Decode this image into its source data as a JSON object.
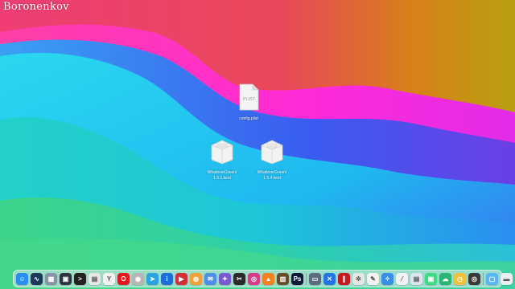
{
  "watermark": {
    "text": "Boronenkov"
  },
  "desktop": {
    "files": [
      {
        "id": "config",
        "label": "config.plist",
        "doc_text": "PLIST"
      },
      {
        "id": "kext1",
        "label": "WhateverGreen/\n1.5.1.kext"
      },
      {
        "id": "kext2",
        "label": "WhateverGreen/\n1.5.4.kext"
      }
    ]
  },
  "wallpaper_colors": {
    "magenta": "#e7387a",
    "orange": "#e0731c",
    "olive": "#b49a12",
    "pink": "#ff2bd6",
    "blue": "#3f54ee",
    "cyan": "#22d4f0",
    "teal": "#1ec9b5",
    "green": "#3ad27c"
  },
  "dock": {
    "items": [
      {
        "name": "finder-icon",
        "color": "#2a8df0",
        "glyph": "☺"
      },
      {
        "name": "activity-monitor-icon",
        "color": "#1e3a5a",
        "glyph": "∿"
      },
      {
        "name": "launchpad-icon",
        "color": "#8a94a8",
        "glyph": "▦"
      },
      {
        "name": "mission-control-icon",
        "color": "#2d3440",
        "glyph": "▣"
      },
      {
        "name": "terminal-icon",
        "color": "#222222",
        "glyph": ">"
      },
      {
        "name": "preview-icon",
        "color": "#e8e8e8",
        "glyph": "▤"
      },
      {
        "name": "yandex-browser-icon",
        "color": "#f2f2f2",
        "glyph": "Y"
      },
      {
        "name": "opera-icon",
        "color": "#e1191f",
        "glyph": "O"
      },
      {
        "name": "photo-app-icon",
        "color": "#b5b5b5",
        "glyph": "◉"
      },
      {
        "name": "telegram-icon",
        "color": "#2aa3de",
        "glyph": "➤"
      },
      {
        "name": "imo-icon",
        "color": "#1d6fd6",
        "glyph": "i"
      },
      {
        "name": "video-player-icon",
        "color": "#d22e3c",
        "glyph": "▶"
      },
      {
        "name": "bitwig-icon",
        "color": "#f2a13a",
        "glyph": "◍"
      },
      {
        "name": "mail-icon",
        "color": "#4d8fe8",
        "glyph": "✉"
      },
      {
        "name": "color-app-icon",
        "color": "#7a5ad0",
        "glyph": "✦"
      },
      {
        "name": "final-cut-icon",
        "color": "#2a2a2a",
        "glyph": "✂"
      },
      {
        "name": "motion-icon",
        "color": "#d93b8a",
        "glyph": "◎"
      },
      {
        "name": "vlc-icon",
        "color": "#f58220",
        "glyph": "▲"
      },
      {
        "name": "archive-icon",
        "color": "#6a4b2a",
        "glyph": "▥"
      },
      {
        "name": "photoshop-icon",
        "color": "#0d1b3a",
        "glyph": "Ps"
      },
      {
        "name": "sep-1",
        "color": "sep",
        "glyph": ""
      },
      {
        "name": "disk-utility-icon",
        "color": "#5c6c80",
        "glyph": "▭"
      },
      {
        "name": "xcode-icon",
        "color": "#2376e2",
        "glyph": "✕"
      },
      {
        "name": "parallels-icon",
        "color": "#c51a24",
        "glyph": "∥"
      },
      {
        "name": "compass-icon",
        "color": "#e6e6e6",
        "glyph": "✲"
      },
      {
        "name": "text-editor-icon",
        "color": "#f2f2f2",
        "glyph": "✎"
      },
      {
        "name": "safari-icon",
        "color": "#3a8ee6",
        "glyph": "✧"
      },
      {
        "name": "pages-icon",
        "color": "#f2f2f2",
        "glyph": "⁄"
      },
      {
        "name": "preview-doc-icon",
        "color": "#dde6f0",
        "glyph": "▤"
      },
      {
        "name": "android-file-icon",
        "color": "#3ddc84",
        "glyph": "▣"
      },
      {
        "name": "cloud-drive-icon",
        "color": "#2bb673",
        "glyph": "☁"
      },
      {
        "name": "time-machine-icon",
        "color": "#f0c23a",
        "glyph": "◷"
      },
      {
        "name": "dvd-player-icon",
        "color": "#3a3a3a",
        "glyph": "◎"
      },
      {
        "name": "sep-2",
        "color": "sep",
        "glyph": ""
      },
      {
        "name": "screenshot-folder-icon",
        "color": "#58b6f0",
        "glyph": "▢"
      },
      {
        "name": "downloads-folder-icon",
        "color": "#e8eef4",
        "glyph": "▬"
      },
      {
        "name": "trash-icon",
        "color": "#8f8f8f",
        "glyph": "▯"
      }
    ]
  }
}
